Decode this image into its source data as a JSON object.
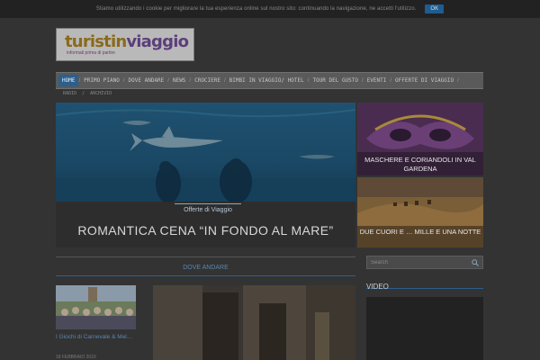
{
  "cookie": {
    "message": "Stiamo utilizzando i cookie per migliorare la tua esperienza online sul nostro sito: continuando la navigazione, ne accetti l'utilizzo.",
    "ok_label": "OK"
  },
  "logo": {
    "part1": "turistin",
    "part2": "viaggio",
    "tagline": "informati prima di partire"
  },
  "nav": {
    "items": [
      {
        "label": "Home",
        "active": true
      },
      {
        "label": "Primo Piano"
      },
      {
        "label": "Dove Andare"
      },
      {
        "label": "News"
      },
      {
        "label": "Crociere"
      },
      {
        "label": "Bimbi in Viaggio/ Hotel"
      },
      {
        "label": "Tour del Gusto"
      },
      {
        "label": "Eventi"
      },
      {
        "label": "Offerte di Viaggio"
      }
    ],
    "subitems": [
      "Radio",
      "Archivio"
    ]
  },
  "hero": {
    "category": "Offerte di Viaggio",
    "title": "ROMANTICA CENA “IN FONDO AL MARE”"
  },
  "side_cards": [
    {
      "title": "MASCHERE E CORIANDOLI IN VAL GARDENA"
    },
    {
      "title": "DUE CUORI E … MILLE E UNA NOTTE"
    }
  ],
  "section": {
    "title": "Dove Andare"
  },
  "articles": [
    {
      "title": "I Giochi di Carnevale & Mel…",
      "date": "18 FEBBRAIO 2016"
    }
  ],
  "sidebar": {
    "search_placeholder": "Search",
    "video_title": "Video"
  },
  "colors": {
    "accent": "#2c5f8e",
    "link": "#5a86b0"
  }
}
